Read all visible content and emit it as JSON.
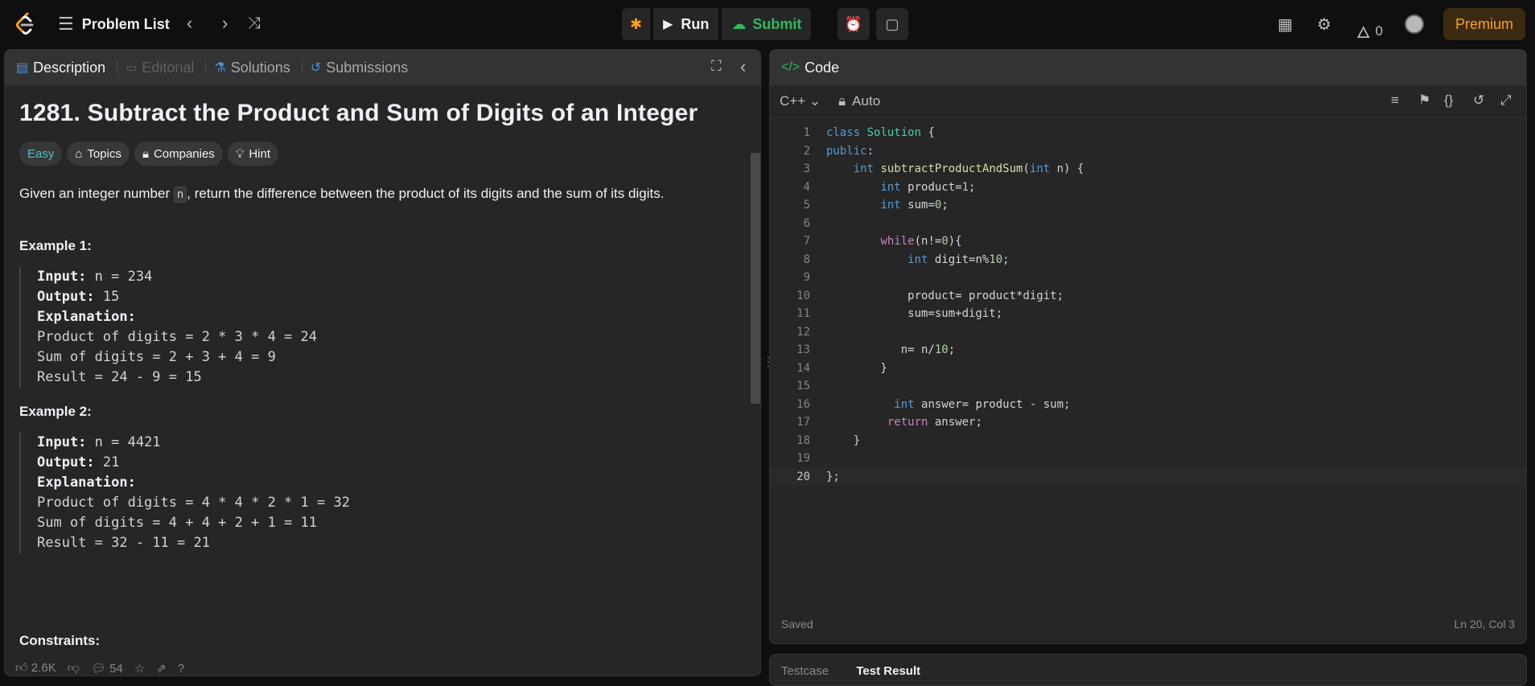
{
  "nav": {
    "problem_list": "Problem List",
    "run": "Run",
    "submit": "Submit",
    "fire_count": "0",
    "premium": "Premium"
  },
  "left_tabs": [
    {
      "label": "Description"
    },
    {
      "label": "Editorial"
    },
    {
      "label": "Solutions"
    },
    {
      "label": "Submissions"
    }
  ],
  "problem": {
    "title": "1281. Subtract the Product and Sum of Digits of an Integer",
    "difficulty": "Easy",
    "tags": [
      "Topics",
      "Companies",
      "Hint"
    ],
    "statement_pre": "Given an integer number ",
    "statement_code": "n",
    "statement_post": ", return the difference between the product of its digits and the sum of its digits.",
    "example1_title": "Example 1:",
    "example1": {
      "input_label": "Input:",
      "input": " n = 234",
      "output_label": "Output:",
      "output": " 15",
      "explanation_label": "Explanation:",
      "lines": [
        "Product of digits = 2 * 3 * 4 = 24",
        "Sum of digits = 2 + 3 + 4 = 9",
        "Result = 24 - 9 = 15"
      ]
    },
    "example2_title": "Example 2:",
    "example2": {
      "input_label": "Input:",
      "input": " n = 4421",
      "output_label": "Output:",
      "output": " 21",
      "explanation_label": "Explanation:",
      "lines": [
        "Product of digits = 4 * 4 * 2 * 1 = 32",
        "Sum of digits = 4 + 4 + 2 + 1 = 11",
        "Result = 32 - 11 = 21"
      ]
    },
    "constraints_title": "Constraints:"
  },
  "bottom_bar": {
    "likes": "2.6K",
    "comments": "54"
  },
  "code_panel": {
    "title": "Code",
    "language": "C++",
    "mode": "Auto",
    "status_left": "Saved",
    "status_right": "Ln 20, Col 3"
  },
  "testcase": {
    "tab1": "Testcase",
    "tab2": "Test Result"
  },
  "colors": {
    "accent": "#ffa116",
    "success": "#2cbb5d",
    "easy": "#46c6c2"
  }
}
